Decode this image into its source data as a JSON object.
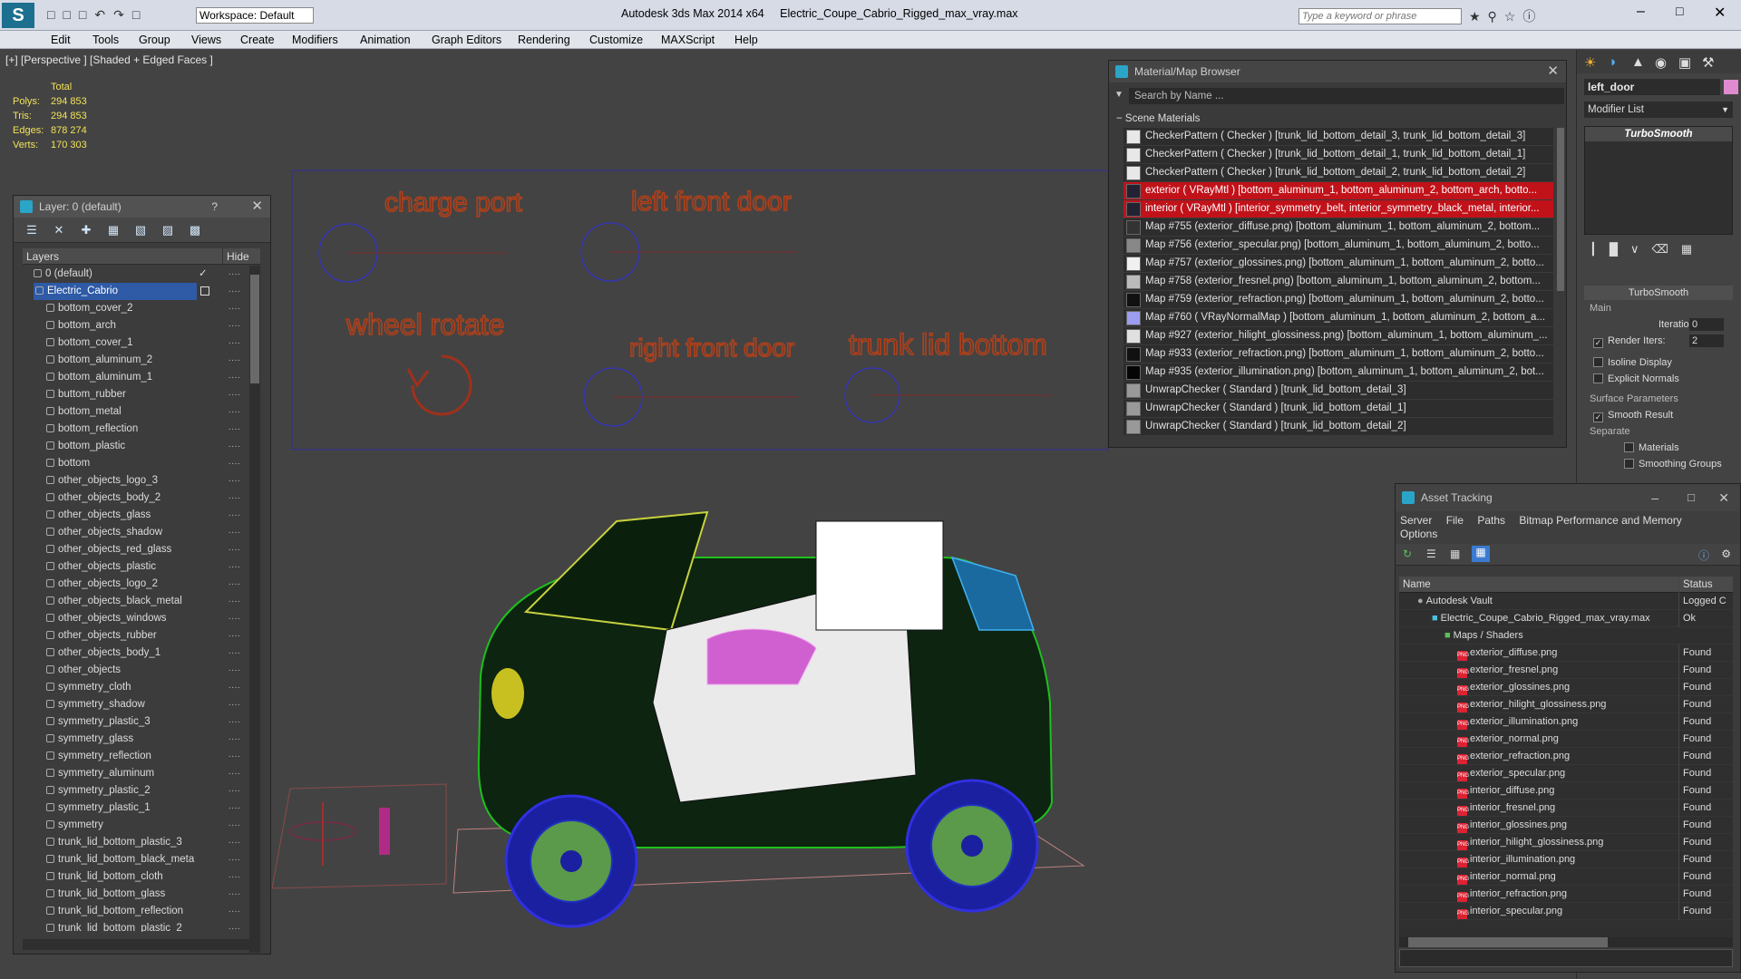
{
  "app": {
    "title": "Autodesk 3ds Max  2014 x64",
    "file": "Electric_Coupe_Cabrio_Rigged_max_vray.max",
    "workspace": "Workspace: Default",
    "search_placeholder": "Type a keyword or phrase"
  },
  "menu": [
    "Edit",
    "Tools",
    "Group",
    "Views",
    "Create",
    "Modifiers",
    "Animation",
    "Graph Editors",
    "Rendering",
    "Customize",
    "MAXScript",
    "Help"
  ],
  "viewport": {
    "label": "[+] [Perspective ] [Shaded + Edged Faces ]",
    "stats": {
      "header": "Total",
      "rows": [
        {
          "k": "Polys:",
          "v": "294 853"
        },
        {
          "k": "Tris:",
          "v": "294 853"
        },
        {
          "k": "Edges:",
          "v": "878 274"
        },
        {
          "k": "Verts:",
          "v": "170 303"
        }
      ]
    },
    "annotations": [
      "charge port",
      "left front door",
      "wheel rotate",
      "right front door",
      "trunk lid bottom"
    ],
    "colors": {
      "bg": "#434343",
      "annotation": "#b0401a",
      "circle": "#3535c0"
    }
  },
  "layer_explorer": {
    "title": "Layer: 0 (default)",
    "help": "?",
    "col_layers": "Layers",
    "col_hide": "Hide",
    "root_layer": "0 (default)",
    "selected_layer": "Electric_Cabrio",
    "objects": [
      "bottom_cover_2",
      "bottom_arch",
      "bottom_cover_1",
      "bottom_aluminum_2",
      "bottom_aluminum_1",
      "buttom_rubber",
      "bottom_metal",
      "bottom_reflection",
      "bottom_plastic",
      "bottom",
      "other_objects_logo_3",
      "other_objects_body_2",
      "other_objects_glass",
      "other_objects_shadow",
      "other_objects_red_glass",
      "other_objects_plastic",
      "other_objects_logo_2",
      "other_objects_black_metal",
      "other_objects_windows",
      "other_objects_rubber",
      "other_objects_body_1",
      "other_objects",
      "symmetry_cloth",
      "symmetry_shadow",
      "symmetry_plastic_3",
      "symmetry_glass",
      "symmetry_reflection",
      "symmetry_aluminum",
      "symmetry_plastic_2",
      "symmetry_plastic_1",
      "symmetry",
      "trunk_lid_bottom_plastic_3",
      "trunk_lid_bottom_black_meta",
      "trunk_lid_bottom_cloth",
      "trunk_lid_bottom_glass",
      "trunk_lid_bottom_reflection",
      "trunk_lid_bottom_plastic_2"
    ]
  },
  "material_browser": {
    "title": "Material/Map Browser",
    "search_placeholder": "Search by Name ...",
    "section": "Scene Materials",
    "items": [
      {
        "label": "CheckerPattern  ( Checker ) [trunk_lid_bottom_detail_3, trunk_lid_bottom_detail_3]",
        "swatch": "#e8e8e8",
        "red": false
      },
      {
        "label": "CheckerPattern  ( Checker ) [trunk_lid_bottom_detail_1, trunk_lid_bottom_detail_1]",
        "swatch": "#e8e8e8",
        "red": false
      },
      {
        "label": "CheckerPattern  ( Checker ) [trunk_lid_bottom_detail_2, trunk_lid_bottom_detail_2]",
        "swatch": "#e8e8e8",
        "red": false
      },
      {
        "label": "exterior  ( VRayMtl ) [bottom_aluminum_1, bottom_aluminum_2, bottom_arch, botto...",
        "swatch": "#222233",
        "red": true
      },
      {
        "label": "interior  ( VRayMtl ) [interior_symmetry_belt, interior_symmetry_black_metal, interior...",
        "swatch": "#222233",
        "red": true
      },
      {
        "label": "Map #755 (exterior_diffuse.png) [bottom_aluminum_1, bottom_aluminum_2, bottom...",
        "swatch": "#333",
        "red": false
      },
      {
        "label": "Map #756 (exterior_specular.png) [bottom_aluminum_1, bottom_aluminum_2, botto...",
        "swatch": "#888",
        "red": false
      },
      {
        "label": "Map #757 (exterior_glossines.png) [bottom_aluminum_1, bottom_aluminum_2, botto...",
        "swatch": "#f0f0f0",
        "red": false
      },
      {
        "label": "Map #758 (exterior_fresnel.png) [bottom_aluminum_1, bottom_aluminum_2, bottom...",
        "swatch": "#bbbbbb",
        "red": false
      },
      {
        "label": "Map #759 (exterior_refraction.png) [bottom_aluminum_1, bottom_aluminum_2, botto...",
        "swatch": "#111",
        "red": false
      },
      {
        "label": "Map #760  ( VRayNormalMap ) [bottom_aluminum_1, bottom_aluminum_2, bottom_a...",
        "swatch": "#9c9cf0",
        "red": false
      },
      {
        "label": "Map #927 (exterior_hilight_glossiness.png) [bottom_aluminum_1, bottom_aluminum_...",
        "swatch": "#e0e0e0",
        "red": false
      },
      {
        "label": "Map #933 (exterior_refraction.png) [bottom_aluminum_1, bottom_aluminum_2, botto...",
        "swatch": "#111",
        "red": false
      },
      {
        "label": "Map #935 (exterior_illumination.png) [bottom_aluminum_1, bottom_aluminum_2, bot...",
        "swatch": "#050505",
        "red": false
      },
      {
        "label": "UnwrapChecker  ( Standard ) [trunk_lid_bottom_detail_3]",
        "swatch": "#999",
        "red": false
      },
      {
        "label": "UnwrapChecker  ( Standard ) [trunk_lid_bottom_detail_1]",
        "swatch": "#999",
        "red": false
      },
      {
        "label": "UnwrapChecker  ( Standard ) [trunk_lid_bottom_detail_2]",
        "swatch": "#999",
        "red": false
      }
    ]
  },
  "command_panel": {
    "object_name": "left_door",
    "modifier_list": "Modifier List",
    "stack_item": "TurboSmooth",
    "rollout_title": "TurboSmooth",
    "main_group": "Main",
    "iterations_label": "Iterations:",
    "iterations_value": "0",
    "render_iters_label": "Render Iters:",
    "render_iters_value": "2",
    "isoline": "Isoline Display",
    "explicit": "Explicit Normals",
    "surface_group": "Surface Parameters",
    "smooth_result": "Smooth Result",
    "separate": "Separate",
    "materials": "Materials",
    "smoothing_groups": "Smoothing Groups"
  },
  "asset_tracking": {
    "title": "Asset Tracking",
    "menu": [
      "Server",
      "File",
      "Paths",
      "Bitmap Performance and Memory"
    ],
    "options": "Options",
    "col_name": "Name",
    "col_status": "Status",
    "vault": {
      "name": "Autodesk Vault",
      "status": "Logged C"
    },
    "file": {
      "name": "Electric_Coupe_Cabrio_Rigged_max_vray.max",
      "status": "Ok"
    },
    "group": "Maps / Shaders",
    "maps": [
      "exterior_diffuse.png",
      "exterior_fresnel.png",
      "exterior_glossines.png",
      "exterior_hilight_glossiness.png",
      "exterior_illumination.png",
      "exterior_normal.png",
      "exterior_refraction.png",
      "exterior_specular.png",
      "interior_diffuse.png",
      "interior_fresnel.png",
      "interior_glossines.png",
      "interior_hilight_glossiness.png",
      "interior_illumination.png",
      "interior_normal.png",
      "interior_refraction.png",
      "interior_specular.png"
    ],
    "found": "Found"
  }
}
